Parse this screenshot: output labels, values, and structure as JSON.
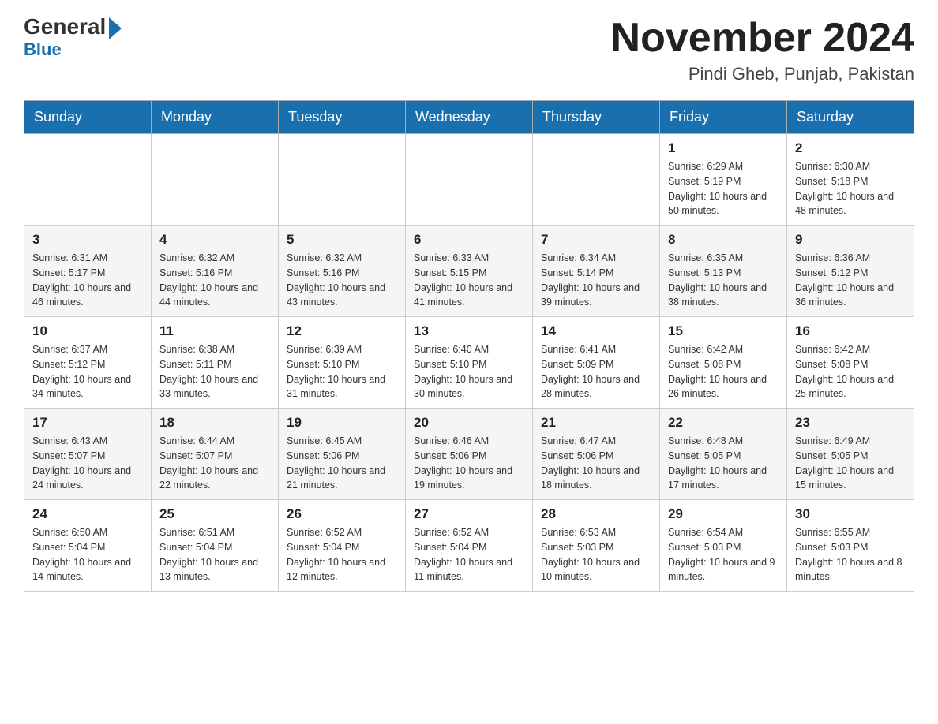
{
  "header": {
    "logo_general": "General",
    "logo_blue": "Blue",
    "month_title": "November 2024",
    "location": "Pindi Gheb, Punjab, Pakistan"
  },
  "days_of_week": [
    "Sunday",
    "Monday",
    "Tuesday",
    "Wednesday",
    "Thursday",
    "Friday",
    "Saturday"
  ],
  "weeks": [
    [
      {
        "day": "",
        "info": ""
      },
      {
        "day": "",
        "info": ""
      },
      {
        "day": "",
        "info": ""
      },
      {
        "day": "",
        "info": ""
      },
      {
        "day": "",
        "info": ""
      },
      {
        "day": "1",
        "info": "Sunrise: 6:29 AM\nSunset: 5:19 PM\nDaylight: 10 hours and 50 minutes."
      },
      {
        "day": "2",
        "info": "Sunrise: 6:30 AM\nSunset: 5:18 PM\nDaylight: 10 hours and 48 minutes."
      }
    ],
    [
      {
        "day": "3",
        "info": "Sunrise: 6:31 AM\nSunset: 5:17 PM\nDaylight: 10 hours and 46 minutes."
      },
      {
        "day": "4",
        "info": "Sunrise: 6:32 AM\nSunset: 5:16 PM\nDaylight: 10 hours and 44 minutes."
      },
      {
        "day": "5",
        "info": "Sunrise: 6:32 AM\nSunset: 5:16 PM\nDaylight: 10 hours and 43 minutes."
      },
      {
        "day": "6",
        "info": "Sunrise: 6:33 AM\nSunset: 5:15 PM\nDaylight: 10 hours and 41 minutes."
      },
      {
        "day": "7",
        "info": "Sunrise: 6:34 AM\nSunset: 5:14 PM\nDaylight: 10 hours and 39 minutes."
      },
      {
        "day": "8",
        "info": "Sunrise: 6:35 AM\nSunset: 5:13 PM\nDaylight: 10 hours and 38 minutes."
      },
      {
        "day": "9",
        "info": "Sunrise: 6:36 AM\nSunset: 5:12 PM\nDaylight: 10 hours and 36 minutes."
      }
    ],
    [
      {
        "day": "10",
        "info": "Sunrise: 6:37 AM\nSunset: 5:12 PM\nDaylight: 10 hours and 34 minutes."
      },
      {
        "day": "11",
        "info": "Sunrise: 6:38 AM\nSunset: 5:11 PM\nDaylight: 10 hours and 33 minutes."
      },
      {
        "day": "12",
        "info": "Sunrise: 6:39 AM\nSunset: 5:10 PM\nDaylight: 10 hours and 31 minutes."
      },
      {
        "day": "13",
        "info": "Sunrise: 6:40 AM\nSunset: 5:10 PM\nDaylight: 10 hours and 30 minutes."
      },
      {
        "day": "14",
        "info": "Sunrise: 6:41 AM\nSunset: 5:09 PM\nDaylight: 10 hours and 28 minutes."
      },
      {
        "day": "15",
        "info": "Sunrise: 6:42 AM\nSunset: 5:08 PM\nDaylight: 10 hours and 26 minutes."
      },
      {
        "day": "16",
        "info": "Sunrise: 6:42 AM\nSunset: 5:08 PM\nDaylight: 10 hours and 25 minutes."
      }
    ],
    [
      {
        "day": "17",
        "info": "Sunrise: 6:43 AM\nSunset: 5:07 PM\nDaylight: 10 hours and 24 minutes."
      },
      {
        "day": "18",
        "info": "Sunrise: 6:44 AM\nSunset: 5:07 PM\nDaylight: 10 hours and 22 minutes."
      },
      {
        "day": "19",
        "info": "Sunrise: 6:45 AM\nSunset: 5:06 PM\nDaylight: 10 hours and 21 minutes."
      },
      {
        "day": "20",
        "info": "Sunrise: 6:46 AM\nSunset: 5:06 PM\nDaylight: 10 hours and 19 minutes."
      },
      {
        "day": "21",
        "info": "Sunrise: 6:47 AM\nSunset: 5:06 PM\nDaylight: 10 hours and 18 minutes."
      },
      {
        "day": "22",
        "info": "Sunrise: 6:48 AM\nSunset: 5:05 PM\nDaylight: 10 hours and 17 minutes."
      },
      {
        "day": "23",
        "info": "Sunrise: 6:49 AM\nSunset: 5:05 PM\nDaylight: 10 hours and 15 minutes."
      }
    ],
    [
      {
        "day": "24",
        "info": "Sunrise: 6:50 AM\nSunset: 5:04 PM\nDaylight: 10 hours and 14 minutes."
      },
      {
        "day": "25",
        "info": "Sunrise: 6:51 AM\nSunset: 5:04 PM\nDaylight: 10 hours and 13 minutes."
      },
      {
        "day": "26",
        "info": "Sunrise: 6:52 AM\nSunset: 5:04 PM\nDaylight: 10 hours and 12 minutes."
      },
      {
        "day": "27",
        "info": "Sunrise: 6:52 AM\nSunset: 5:04 PM\nDaylight: 10 hours and 11 minutes."
      },
      {
        "day": "28",
        "info": "Sunrise: 6:53 AM\nSunset: 5:03 PM\nDaylight: 10 hours and 10 minutes."
      },
      {
        "day": "29",
        "info": "Sunrise: 6:54 AM\nSunset: 5:03 PM\nDaylight: 10 hours and 9 minutes."
      },
      {
        "day": "30",
        "info": "Sunrise: 6:55 AM\nSunset: 5:03 PM\nDaylight: 10 hours and 8 minutes."
      }
    ]
  ]
}
